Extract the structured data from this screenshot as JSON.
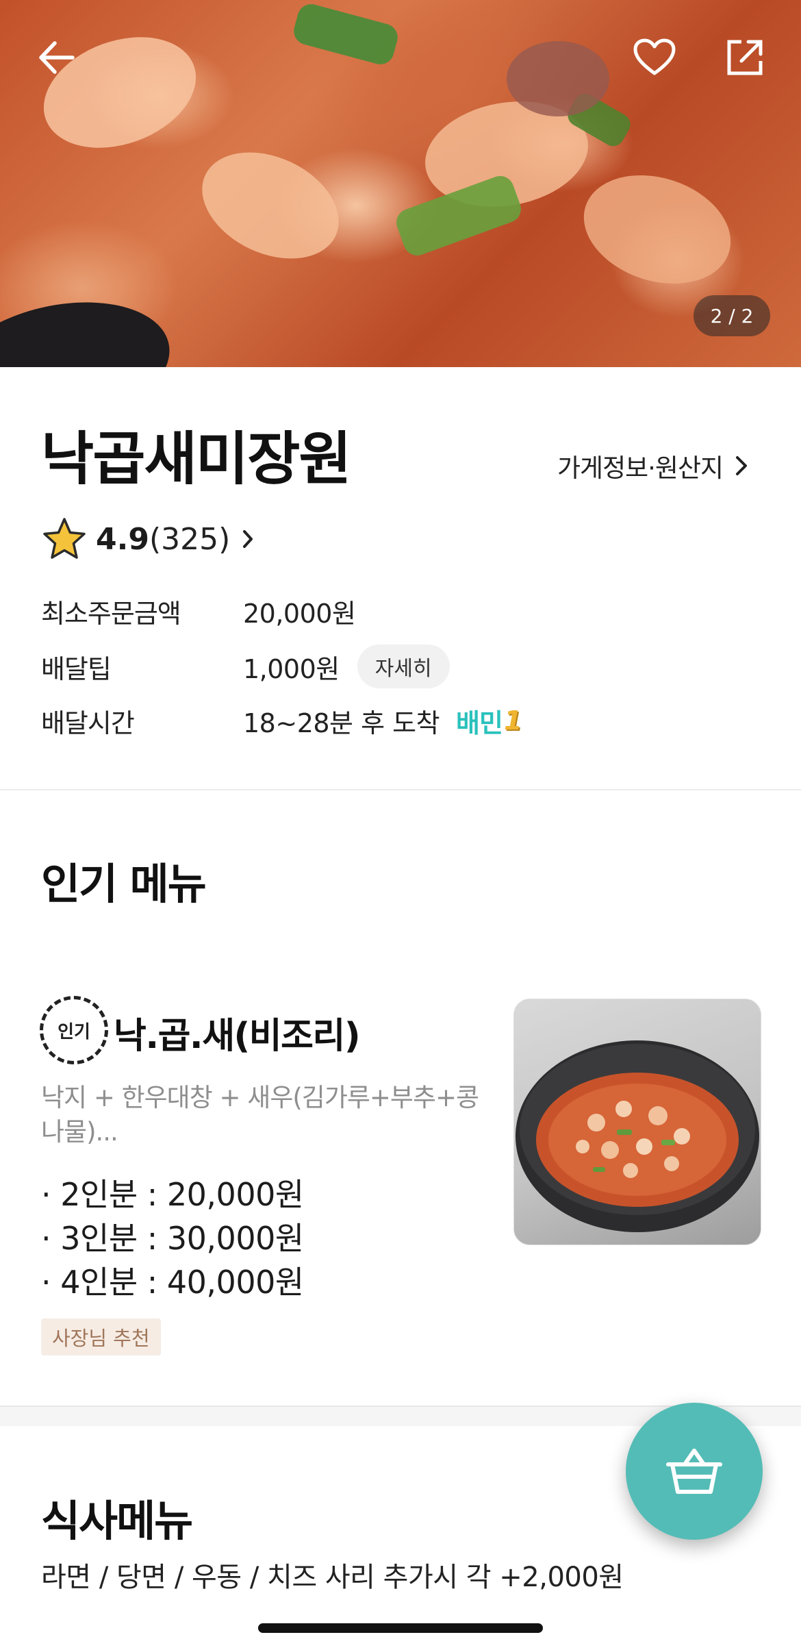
{
  "hero": {
    "counter": "2 / 2",
    "icons": [
      "back-arrow-icon",
      "heart-icon",
      "share-icon"
    ]
  },
  "store": {
    "name": "낙곱새미장원",
    "info_link": "가게정보·원산지",
    "rating": {
      "score": "4.9",
      "count": "(325)"
    },
    "rows": [
      {
        "label": "최소주문금액",
        "value": "20,000원"
      },
      {
        "label": "배달팁",
        "value": "1,000원",
        "button": "자세히"
      },
      {
        "label": "배달시간",
        "value": "18~28분 후 도착",
        "badge": "배민",
        "badge_num": "1"
      }
    ]
  },
  "popular": {
    "title": "인기 메뉴",
    "item": {
      "badge": "인기",
      "name": "낙.곱.새(비조리)",
      "description": "낙지 + 한우대창 + 새우(김가루+부추+콩나물)...",
      "prices": [
        "· 2인분 : 20,000원",
        "· 3인분 : 30,000원",
        "· 4인분 : 40,000원"
      ],
      "tag": "사장님 추천"
    }
  },
  "meal": {
    "title": "식사메뉴",
    "note": "라면 / 당면 / 우동 / 치즈 사리 추가시 각 +2,000원"
  },
  "colors": {
    "accent": "#2ac1bc",
    "cart_button": "#54bcb6",
    "tag_bg": "#f6ece4",
    "tag_text": "#a0765a",
    "star": "#f5c33b"
  }
}
